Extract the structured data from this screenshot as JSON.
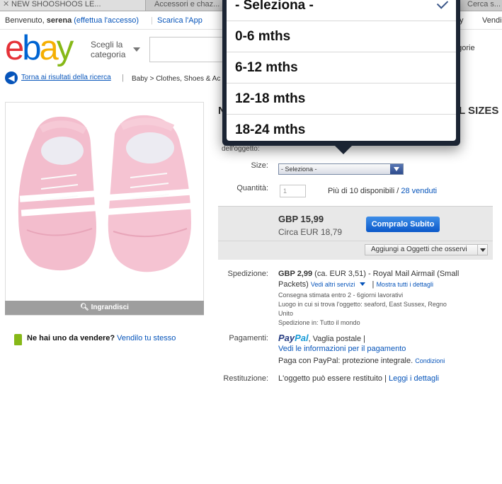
{
  "browser": {
    "tabs": [
      {
        "title": "NEW SHOOSHOOS LE..."
      },
      {
        "title": "Accessori e chaz..."
      },
      {
        "title": "Cerca s..."
      }
    ]
  },
  "topbar": {
    "welcome_prefix": "Benvenuto,",
    "user": "serena",
    "login_link": "(effettua l'accesso)",
    "app_link": "Scarica l'App",
    "right_links": [
      "y",
      "Vendi"
    ]
  },
  "header": {
    "logo": {
      "e": "e",
      "b": "b",
      "a": "a",
      "y": "y"
    },
    "category_label": "Scegli la categoria",
    "advanced": "egorie"
  },
  "breadcrumb": {
    "back_label": "Torna ai risultati della ricerca",
    "path": "Baby > Clothes, Shoes & Ac"
  },
  "product": {
    "enlarge_label": "Ingrandisci",
    "title_left": "N",
    "title_right": "L SIZES",
    "obj_state_label": "dell'oggetto:",
    "size_label": "Size:",
    "size_value": "- Seleziona -",
    "qty_label": "Quantità:",
    "qty_value": "1",
    "availability": "Più di 10 disponibili /",
    "sold_link": "28 venduti",
    "price": "GBP 15,99",
    "price_eur": "Circa EUR 18,79",
    "buy_label": "Compralo Subito",
    "watch_label": "Aggiungi a Oggetti che osservi"
  },
  "sell_prompt": {
    "question": "Ne hai uno da vendere?",
    "link": "Vendilo tu stesso"
  },
  "shipping": {
    "label": "Spedizione:",
    "cost": "GBP 2,99",
    "detail_line1": " (ca. EUR 3,51) - Royal Mail Airmail (Small",
    "detail_line2": "Packets)",
    "other_services": "Vedi altri servizi",
    "sep": "|",
    "show_all": "Mostra tutti i dettagli",
    "delivery": "Consegna stimata entro 2 - 6giorni lavorativi",
    "location_line1": "Luogo in cui si trova l'oggetto: seaford, East Sussex, Regno",
    "location_line2": "Unito",
    "ships_to": "Spedizione in: Tutto il mondo"
  },
  "payments": {
    "label": "Pagamenti:",
    "paypal_a": "Pay",
    "paypal_b": "Pal",
    "methods": ", Vaglia postale |",
    "info_link": "Vedi le informazioni per il pagamento",
    "protection": "Paga con PayPal: protezione integrale.",
    "conditions": "Condizioni"
  },
  "returns": {
    "label": "Restituzione:",
    "text": "L'oggetto può essere restituito |",
    "link": "Leggi i dettagli"
  },
  "size_dropdown": {
    "options": [
      "- Seleziona -",
      "0-6 mths",
      "6-12 mths",
      "12-18 mths",
      "18-24 mths"
    ],
    "selected": "- Seleziona -"
  },
  "colors": {
    "ebay_red": "#e53238",
    "ebay_blue": "#0064d2",
    "ebay_yellow": "#f5af02",
    "ebay_green": "#86b817",
    "link_blue": "#0654ba",
    "popover_dark": "#1b2433"
  }
}
